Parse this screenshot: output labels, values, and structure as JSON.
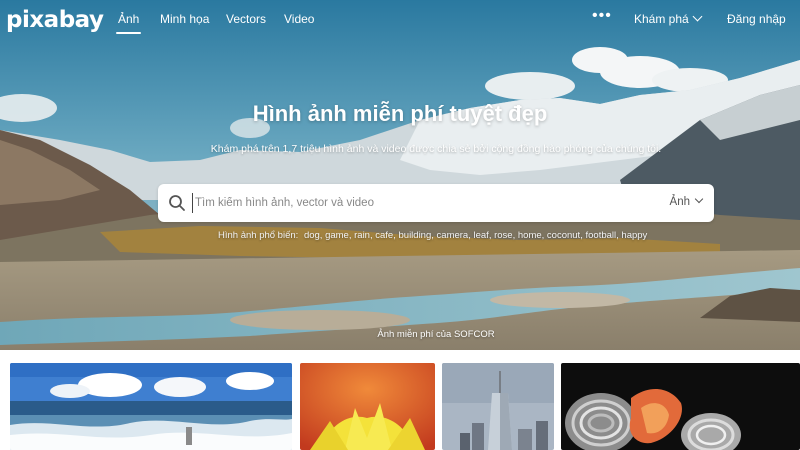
{
  "brand": {
    "logo_text": "pixabay"
  },
  "nav": {
    "items": [
      {
        "label": "Ảnh",
        "active": true
      },
      {
        "label": "Minh họa",
        "active": false
      },
      {
        "label": "Vectors",
        "active": false
      },
      {
        "label": "Video",
        "active": false
      }
    ],
    "more_icon": "more-dots-icon",
    "explore_label": "Khám phá",
    "login_label": "Đăng nhập"
  },
  "hero": {
    "title": "Hình ảnh miễn phí tuyệt đẹp",
    "subtitle": "Khám phá trên 1,7 triệu hình ảnh và video được chia sẻ bởi cộng đồng hào phóng của chúng tôi.",
    "credit": "Ảnh miễn phí của SOFCOR"
  },
  "search": {
    "placeholder": "Tìm kiếm hình ảnh, vector và video",
    "value": "",
    "type_label": "Ảnh",
    "search_icon": "search-icon"
  },
  "popular": {
    "label": "Hình ảnh phổ biến:",
    "tags": [
      "dog",
      "game",
      "rain",
      "cafe",
      "building",
      "camera",
      "leaf",
      "rose",
      "home",
      "coconut",
      "football",
      "happy"
    ]
  },
  "colors": {
    "sky_top": "#2f7fa3",
    "search_bg": "#ffffff",
    "text_on_hero": "#ffffff"
  }
}
